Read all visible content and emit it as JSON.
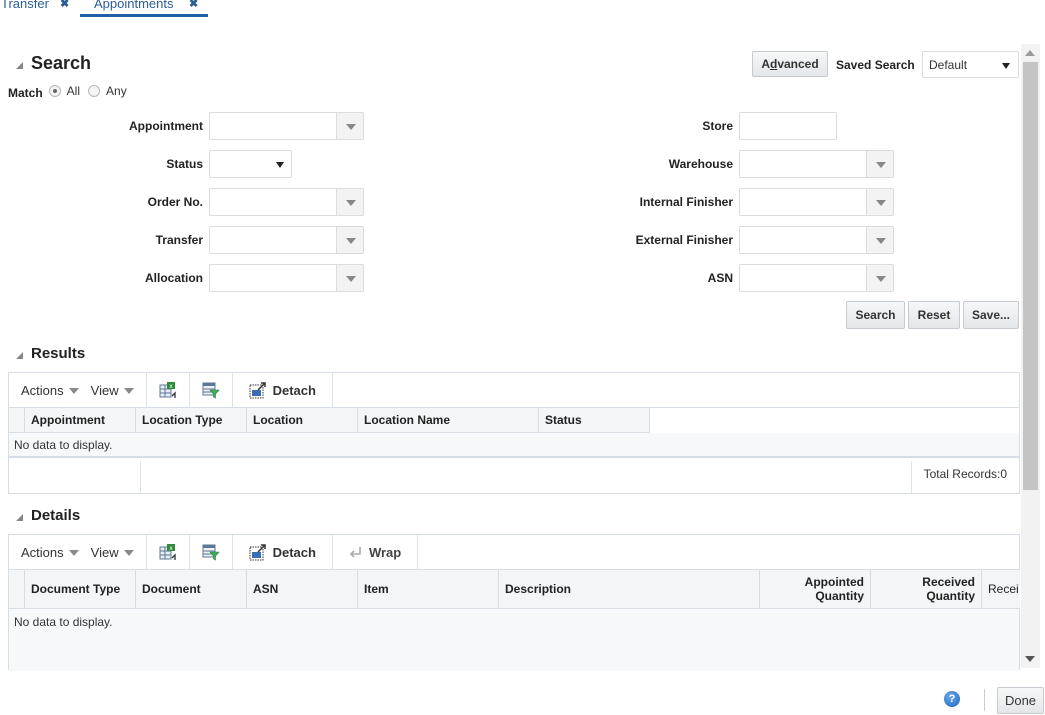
{
  "tabs": [
    {
      "label": "Transfer",
      "active": false
    },
    {
      "label": "Appointments",
      "active": true
    }
  ],
  "search": {
    "title": "Search",
    "match_label": "Match",
    "match_options": [
      "All",
      "Any"
    ],
    "match_selected": "All",
    "advanced_label": "Advanced",
    "advanced_accesskey": "d",
    "saved_search_label": "Saved Search",
    "saved_search_value": "Default",
    "fields_left": [
      {
        "label": "Appointment",
        "type": "combo",
        "value": ""
      },
      {
        "label": "Status",
        "type": "select",
        "value": ""
      },
      {
        "label": "Order No.",
        "type": "combo",
        "value": ""
      },
      {
        "label": "Transfer",
        "type": "combo",
        "value": ""
      },
      {
        "label": "Allocation",
        "type": "combo",
        "value": ""
      }
    ],
    "fields_right": [
      {
        "label": "Store",
        "type": "text",
        "value": ""
      },
      {
        "label": "Warehouse",
        "type": "combo",
        "value": ""
      },
      {
        "label": "Internal Finisher",
        "type": "combo",
        "value": ""
      },
      {
        "label": "External Finisher",
        "type": "combo",
        "value": ""
      },
      {
        "label": "ASN",
        "type": "combo",
        "value": ""
      }
    ],
    "buttons": {
      "search": "Search",
      "reset": "Reset",
      "save": "Save..."
    }
  },
  "results": {
    "title": "Results",
    "toolbar": {
      "actions": "Actions",
      "view": "View",
      "export_icon": "export-to-excel-icon",
      "filter_icon": "query-by-example-icon",
      "detach": "Detach"
    },
    "columns": [
      "Appointment",
      "Location Type",
      "Location",
      "Location Name",
      "Status"
    ],
    "empty_text": "No data to display.",
    "total_records": "Total Records:0"
  },
  "details": {
    "title": "Details",
    "toolbar": {
      "actions": "Actions",
      "view": "View",
      "export_icon": "export-to-excel-icon",
      "filter_icon": "query-by-example-icon",
      "detach": "Detach",
      "wrap": "Wrap"
    },
    "columns": [
      {
        "label": "Document Type"
      },
      {
        "label": "Document"
      },
      {
        "label": "ASN"
      },
      {
        "label": "Item"
      },
      {
        "label": "Description"
      },
      {
        "label": "Appointed\nQuantity",
        "line1": "Appointed",
        "line2": "Quantity"
      },
      {
        "label": "Received\nQuantity",
        "line1": "Received",
        "line2": "Quantity"
      },
      {
        "label": "Recei"
      }
    ],
    "empty_text": "No data to display."
  },
  "footer": {
    "help_icon": "?",
    "done_label": "Done"
  }
}
